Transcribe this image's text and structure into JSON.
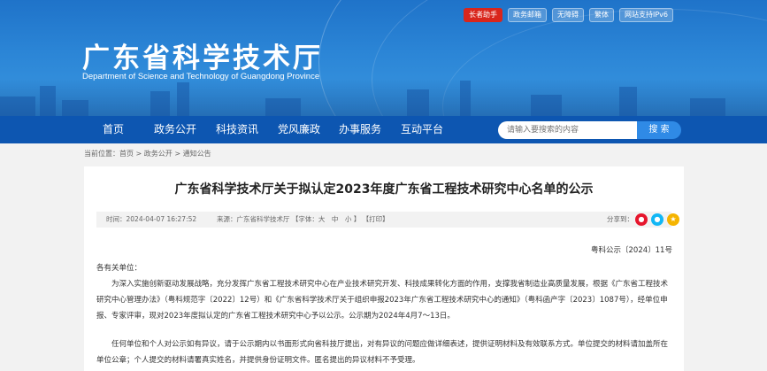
{
  "header": {
    "title": "广东省科学技术厅",
    "subtitle": "Department of Science and Technology of Guangdong Province",
    "top_links": [
      "长者助手",
      "政务邮箱",
      "无障碍",
      "繁体",
      "网站支持IPv6"
    ]
  },
  "nav": {
    "items": [
      "首页",
      "政务公开",
      "科技资讯",
      "党风廉政",
      "办事服务",
      "互动平台"
    ],
    "search_placeholder": "请输入要搜索的内容",
    "search_button": "搜 索"
  },
  "breadcrumb": "当前位置：首页 > 政务公开 > 通知公告",
  "article": {
    "title": "广东省科学技术厅关于拟认定2023年度广东省工程技术研究中心名单的公示",
    "time": "时间：2024-04-07 16:27:52",
    "source": "来源：广东省科学技术厅 【字体：大　中　小 】 【打印】",
    "share_label": "分享到：",
    "doc_number": "粤科公示〔2024〕11号",
    "salutation": "各有关单位：",
    "para1": "为深入实施创新驱动发展战略，充分发挥广东省工程技术研究中心在产业技术研究开发、科技成果转化方面的作用，支撑我省制造业高质量发展，根据《广东省工程技术研究中心管理办法》（粤科规范字〔2022〕12号）和《广东省科学技术厅关于组织申报2023年广东省工程技术研究中心的通知》（粤科函产字〔2023〕1087号），经单位申报、专家评审，现对2023年度拟认定的广东省工程技术研究中心予以公示。公示期为2024年4月7～13日。",
    "para2": "任何单位和个人对公示如有异议，请于公示期内以书面形式向省科技厅提出，对有异议的问题应做详细表述，提供证明材料及有效联系方式。单位提交的材料请加盖所在单位公章；个人提交的材料请署真实姓名，并提供身份证明文件。匿名提出的异议材料不予受理。"
  },
  "colors": {
    "nav_bg": "#0d56b1",
    "elder_assist": "#d9261c",
    "search_button": "#2f8ae6"
  }
}
